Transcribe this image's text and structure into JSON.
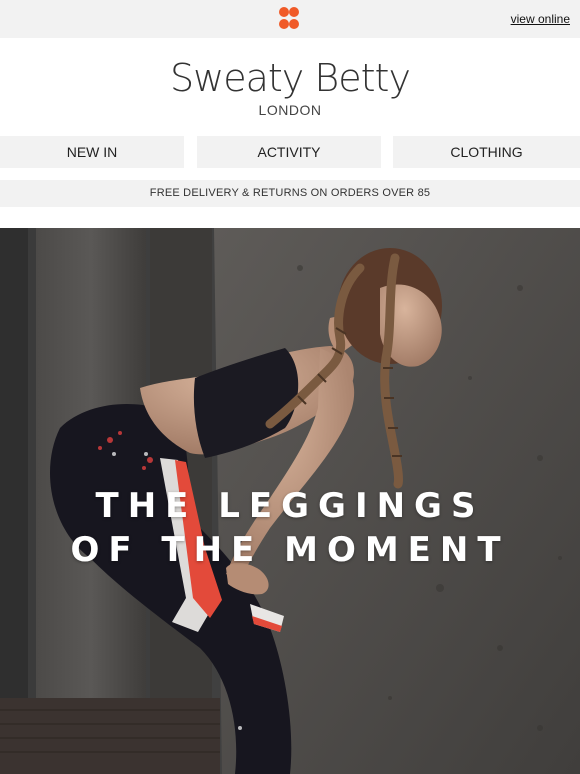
{
  "header": {
    "view_online": "view online",
    "logo_icon": "four-dot-flower-icon",
    "brand_color": "#f05a28"
  },
  "brand": {
    "name": "Sweaty Betty",
    "location": "LONDON"
  },
  "nav": {
    "items": [
      {
        "label": "NEW IN"
      },
      {
        "label": "ACTIVITY"
      },
      {
        "label": "CLOTHING"
      }
    ]
  },
  "promo": {
    "delivery_text": "FREE DELIVERY & RETURNS ON ORDERS OVER 85"
  },
  "hero": {
    "line1": "THE LEGGINGS",
    "line2": "OF THE MOMENT"
  }
}
